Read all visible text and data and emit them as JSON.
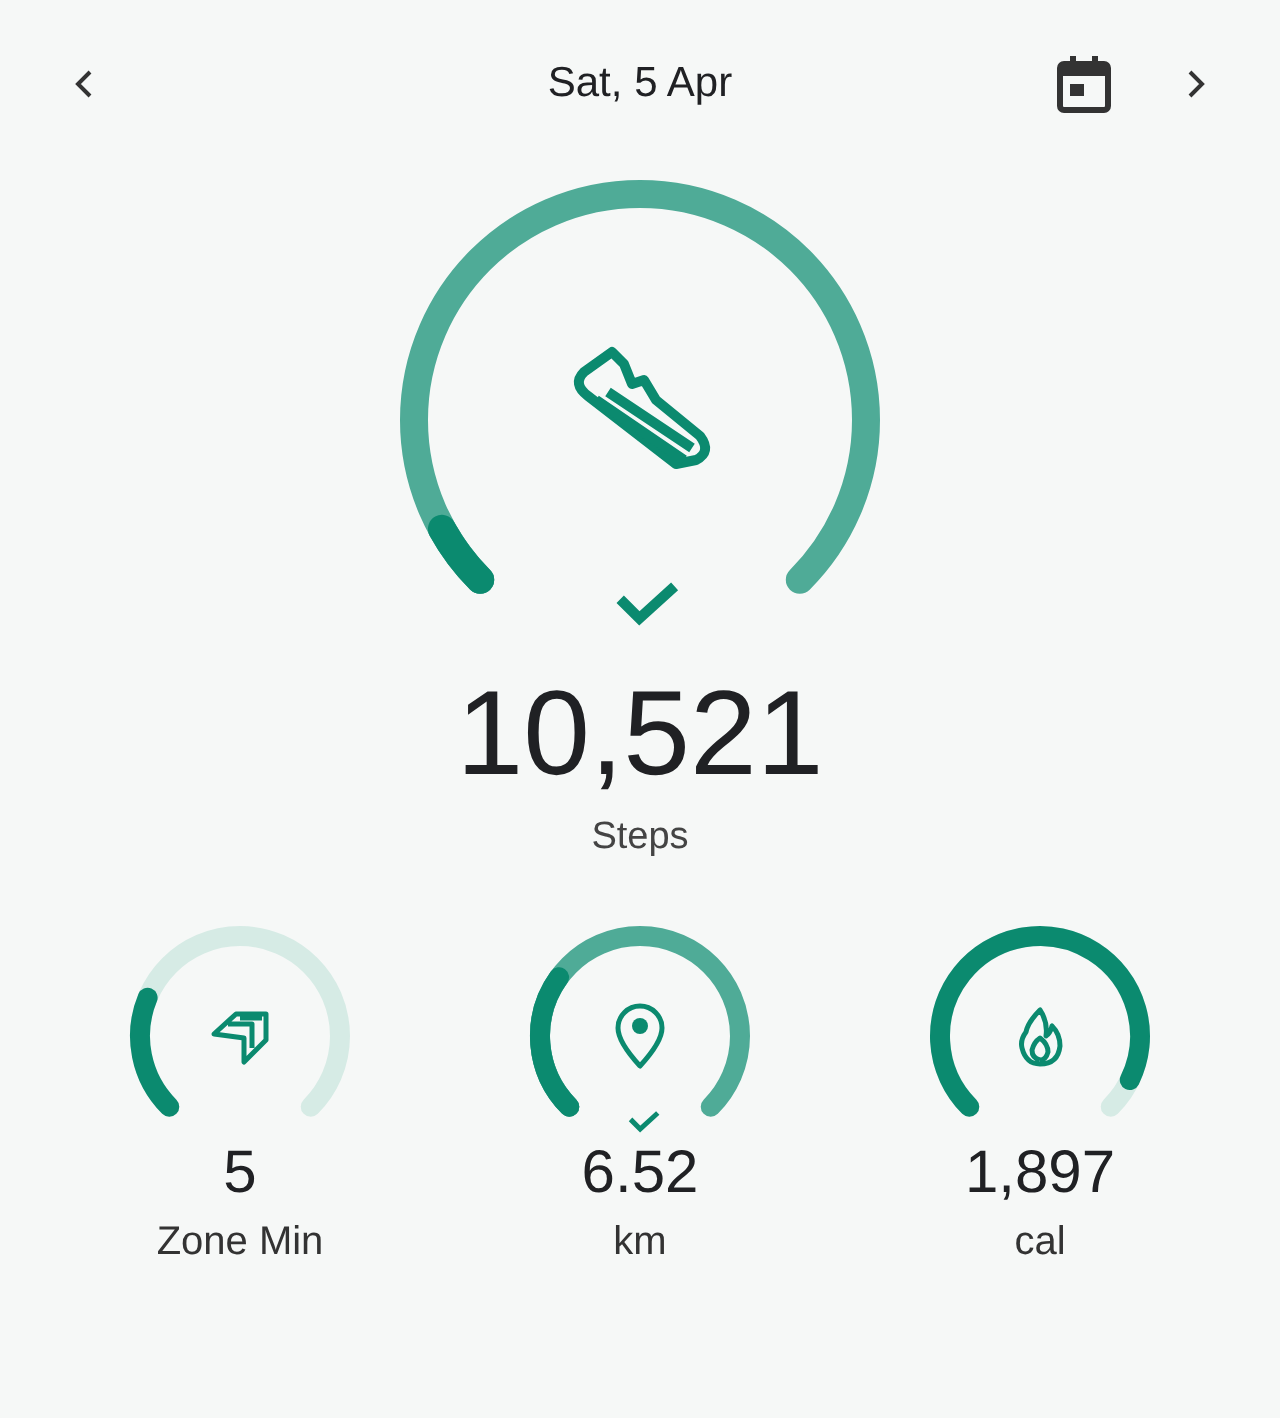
{
  "header": {
    "title": "Sat, 5 Apr"
  },
  "main": {
    "achieved": true,
    "value": "10,521",
    "label": "Steps"
  },
  "metrics": [
    {
      "kind": "zone",
      "achieved": false,
      "value": "5",
      "label": "Zone Min"
    },
    {
      "kind": "distance",
      "achieved": true,
      "value": "6.52",
      "label": "km"
    },
    {
      "kind": "energy",
      "achieved": false,
      "value": "1,897",
      "label": "cal"
    }
  ]
}
